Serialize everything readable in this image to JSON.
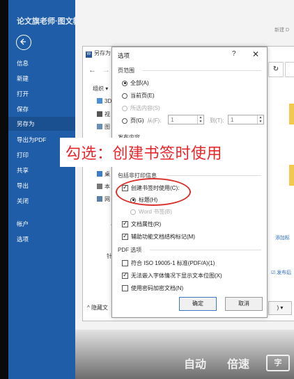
{
  "backstage": {
    "title": "论文旗老师·图文教程",
    "items": [
      "信息",
      "新建",
      "打开",
      "保存",
      "另存为",
      "导出为PDF",
      "打印",
      "共享",
      "导出",
      "关闭",
      "帐户",
      "选项"
    ],
    "active_index": 4
  },
  "top_right_text": "新建 D",
  "saveas": {
    "title": "另存为",
    "organize": "组织 ▾",
    "tree_items": [
      "3D",
      "视",
      "图",
      "桌",
      "本",
      "网"
    ],
    "hide_folders": "^ 隐藏文",
    "add_tag": "添加标",
    "publish": "☑ 发布后",
    "bottom_btn": ") ▾",
    "label_shang": "包",
    "label_zhen": "针"
  },
  "dialog": {
    "title": "选项",
    "help": "?",
    "close": "✕",
    "section_page_range": "页范围",
    "radio_all": "全部(A)",
    "radio_current": "当前页(E)",
    "radio_selection": "所选内容(S)",
    "radio_pages": "页(G)",
    "from_label": "从(F):",
    "from_value": "1",
    "to_label": "到(T):",
    "to_value": "1",
    "section_publish": "发布内容",
    "section_nonprint": "包括非打印信息",
    "chk_bookmarks": "创建书签时使用(C):",
    "radio_headings": "标题(H)",
    "radio_word_bookmarks": "Word 书签(B)",
    "chk_doc_props": "文档属性(R)",
    "chk_struct_tags": "辅助功能文档结构标记(M)",
    "section_pdf": "PDF 选项",
    "chk_pdfa": "符合 ISO 19005-1 标准(PDF/A)(1)",
    "chk_bitmap": "无法嵌入字体情况下显示文本位图(X)",
    "chk_encrypt": "使用密码加密文档(N)",
    "ok": "确定",
    "cancel": "取消"
  },
  "overlay": {
    "caption": "勾选：创建书签时使用",
    "caption_color": "#e8262b"
  },
  "video_controls": {
    "auto": "自动",
    "speed": "倍速",
    "subtitle": "字"
  },
  "colors": {
    "backstage_blue": "#1f5da8",
    "highlight_red": "#d9322e"
  }
}
